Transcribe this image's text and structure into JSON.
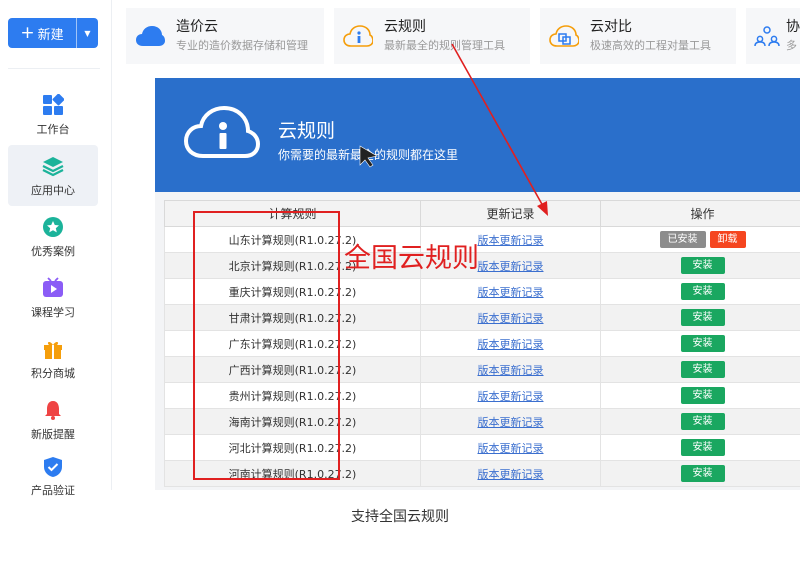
{
  "sidebar": {
    "new_label": "新建",
    "items": [
      {
        "label": "工作台",
        "icon": "grid-icon"
      },
      {
        "label": "应用中心",
        "icon": "layers-icon"
      },
      {
        "label": "优秀案例",
        "icon": "star-icon"
      },
      {
        "label": "课程学习",
        "icon": "video-icon"
      },
      {
        "label": "积分商城",
        "icon": "gift-icon"
      },
      {
        "label": "新版提醒",
        "icon": "bell-icon"
      },
      {
        "label": "产品验证",
        "icon": "shield-icon"
      }
    ]
  },
  "cards": [
    {
      "title": "造价云",
      "subtitle": "专业的造价数据存储和管理",
      "icon": "cloud-icon"
    },
    {
      "title": "云规则",
      "subtitle": "最新最全的规则管理工具",
      "icon": "cloud-info-icon"
    },
    {
      "title": "云对比",
      "subtitle": "极速高效的工程对量工具",
      "icon": "cloud-compare-icon"
    },
    {
      "title": "协",
      "subtitle": "多",
      "icon": "team-icon"
    }
  ],
  "banner": {
    "title": "云规则",
    "subtitle": "你需要的最新最全的规则都在这里"
  },
  "table": {
    "headers": [
      "计算规则",
      "更新记录",
      "操作"
    ],
    "installed_label": "已安装",
    "uninstall_label": "卸载",
    "install_label": "安装",
    "rows": [
      {
        "rule": "山东计算规则(R1.0.27.2)",
        "record": "版本更新记录",
        "installed": true
      },
      {
        "rule": "北京计算规则(R1.0.27.2)",
        "record": "版本更新记录",
        "installed": false
      },
      {
        "rule": "重庆计算规则(R1.0.27.2)",
        "record": "版本更新记录",
        "installed": false
      },
      {
        "rule": "甘肃计算规则(R1.0.27.2)",
        "record": "版本更新记录",
        "installed": false
      },
      {
        "rule": "广东计算规则(R1.0.27.2)",
        "record": "版本更新记录",
        "installed": false
      },
      {
        "rule": "广西计算规则(R1.0.27.2)",
        "record": "版本更新记录",
        "installed": false
      },
      {
        "rule": "贵州计算规则(R1.0.27.2)",
        "record": "版本更新记录",
        "installed": false
      },
      {
        "rule": "海南计算规则(R1.0.27.2)",
        "record": "版本更新记录",
        "installed": false
      },
      {
        "rule": "河北计算规则(R1.0.27.2)",
        "record": "版本更新记录",
        "installed": false
      },
      {
        "rule": "河南计算规则(R1.0.27.2)",
        "record": "版本更新记录",
        "installed": false
      }
    ]
  },
  "annotation": {
    "text": "全国云规则"
  },
  "caption": "支持全国云规则",
  "colors": {
    "primary": "#2d7cf0",
    "banner": "#2a6fcb",
    "install": "#1aa760",
    "uninstall": "#f5451f",
    "installed": "#8c8c8c",
    "annotation": "#e02020"
  }
}
